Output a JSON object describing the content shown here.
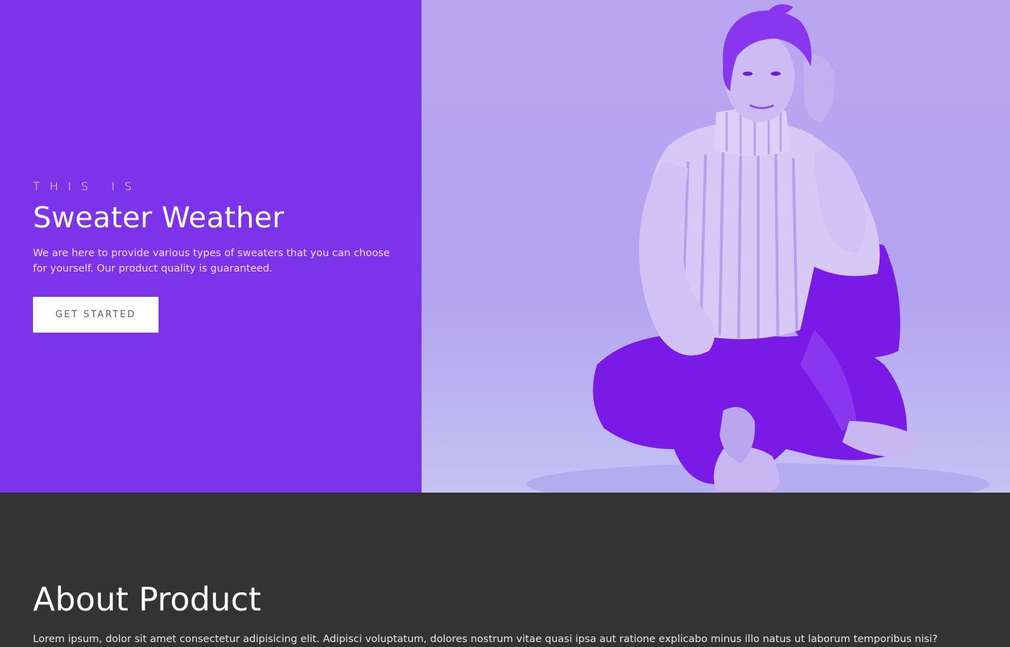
{
  "hero": {
    "eyebrow": "THIS IS",
    "title": "Sweater Weather",
    "description": "We are here to provide various types of sweaters that you can choose for yourself. Our product quality is guaranteed.",
    "cta_label": "GET STARTED",
    "colors": {
      "panel": "#7d33e9",
      "photo_tint": "#b7a4f0",
      "button_bg": "#ffffff"
    }
  },
  "about": {
    "title": "About Product",
    "text": "Lorem ipsum, dolor sit amet consectetur adipisicing elit. Adipisci voluptatum, dolores nostrum vitae quasi ipsa aut ratione explicabo minus illo natus ut laborum temporibus nisi?",
    "colors": {
      "background": "#333333"
    }
  }
}
